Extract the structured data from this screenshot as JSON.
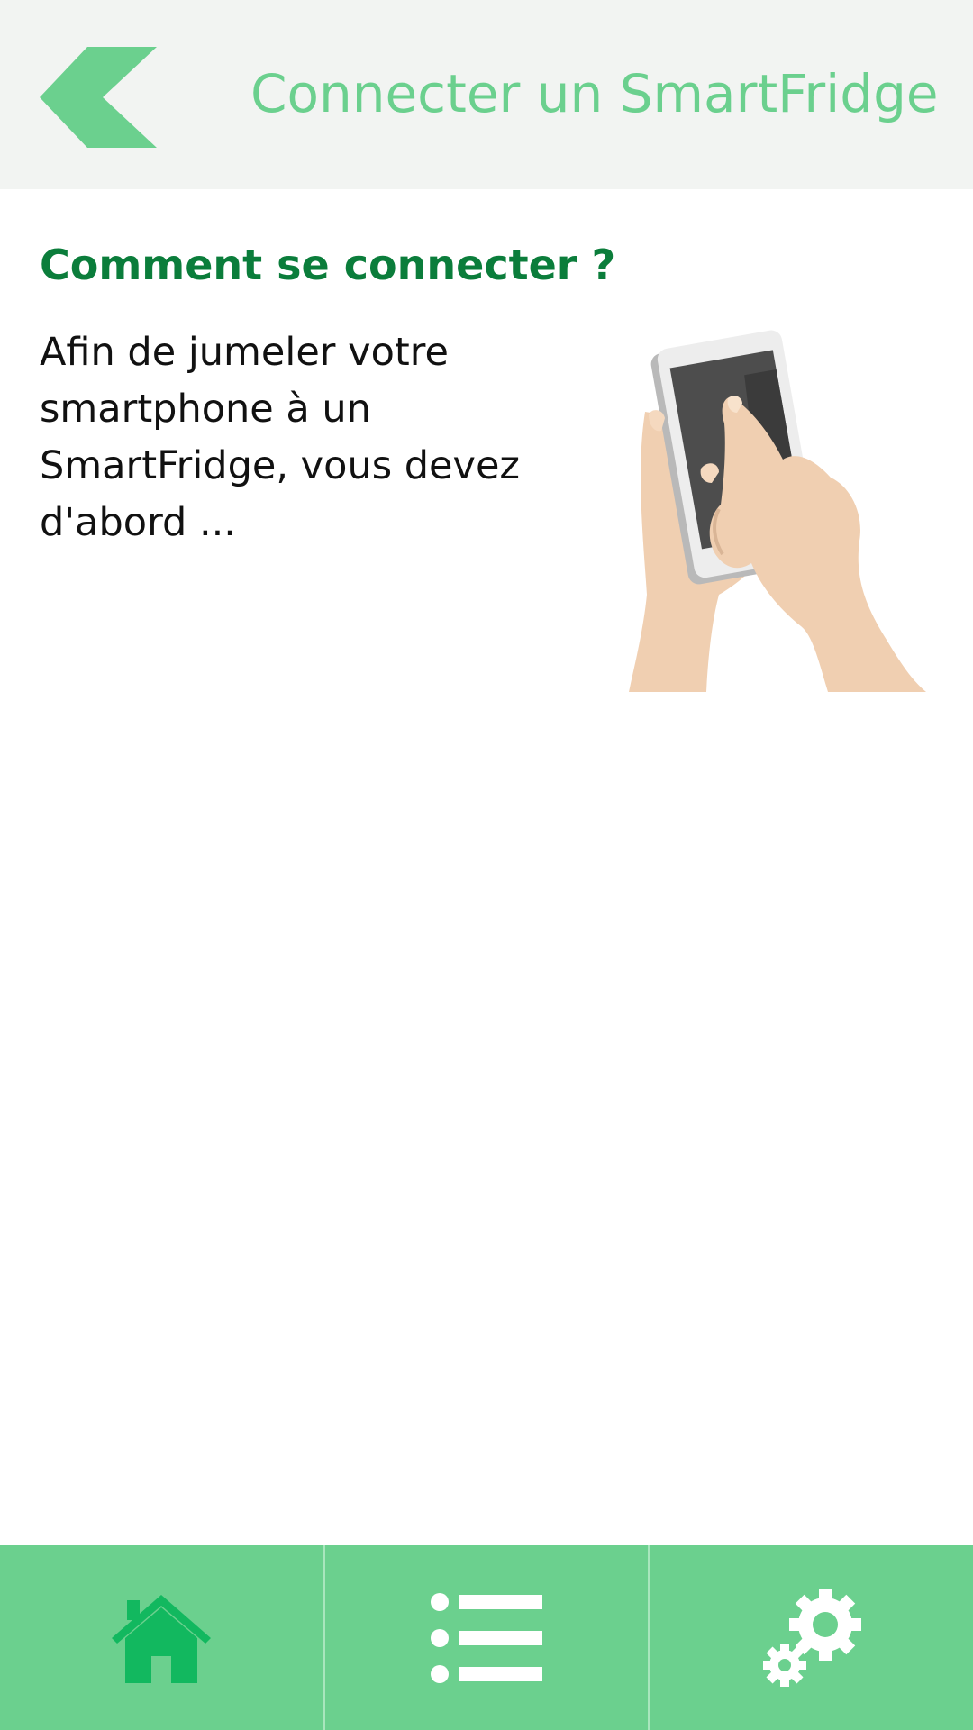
{
  "header": {
    "title": "Connecter un SmartFridge",
    "back_icon": "chevron-left-icon"
  },
  "main": {
    "heading": "Comment se connecter ?",
    "intro_text": "Afin de jumeler votre smartphone à un SmartFridge, vous devez d'abord ...",
    "illustration": "hands-holding-smartphone"
  },
  "bottom_nav": {
    "items": [
      {
        "icon": "home-icon",
        "active": true
      },
      {
        "icon": "list-icon",
        "active": false
      },
      {
        "icon": "gears-icon",
        "active": false
      }
    ]
  },
  "colors": {
    "accent": "#6bd08e",
    "accent_dark": "#12b85f",
    "heading": "#0b7d3b",
    "header_bg": "#f2f4f2"
  }
}
